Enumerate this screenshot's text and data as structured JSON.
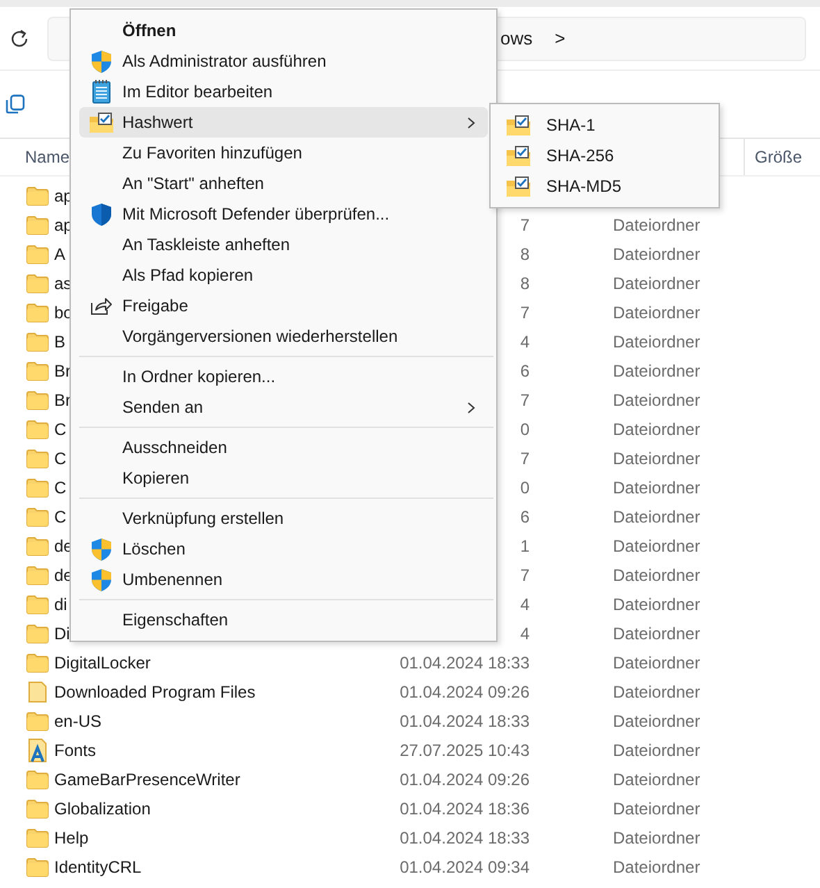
{
  "address_bar": {
    "path_text": "ows",
    "chevron": ">"
  },
  "columns": {
    "name": "Name",
    "size": "Größe"
  },
  "rows": [
    {
      "kind": "folder",
      "name": "ap",
      "date": "",
      "type": ""
    },
    {
      "kind": "folder",
      "name": "ap",
      "date": "7",
      "type": "Dateiordner"
    },
    {
      "kind": "folder",
      "name": "A",
      "date": "8",
      "type": "Dateiordner"
    },
    {
      "kind": "folder",
      "name": "as",
      "date": "8",
      "type": "Dateiordner"
    },
    {
      "kind": "folder",
      "name": "bo",
      "date": "7",
      "type": "Dateiordner"
    },
    {
      "kind": "folder",
      "name": "B",
      "date": "4",
      "type": "Dateiordner"
    },
    {
      "kind": "folder",
      "name": "Br",
      "date": "6",
      "type": "Dateiordner"
    },
    {
      "kind": "folder",
      "name": "Br",
      "date": "7",
      "type": "Dateiordner"
    },
    {
      "kind": "folder",
      "name": "C",
      "date": "0",
      "type": "Dateiordner"
    },
    {
      "kind": "folder",
      "name": "C",
      "date": "7",
      "type": "Dateiordner"
    },
    {
      "kind": "folder",
      "name": "C",
      "date": "0",
      "type": "Dateiordner"
    },
    {
      "kind": "folder",
      "name": "C",
      "date": "6",
      "type": "Dateiordner"
    },
    {
      "kind": "folder",
      "name": "de",
      "date": "1",
      "type": "Dateiordner"
    },
    {
      "kind": "folder",
      "name": "de",
      "date": "7",
      "type": "Dateiordner"
    },
    {
      "kind": "folder",
      "name": "di",
      "date": "4",
      "type": "Dateiordner"
    },
    {
      "kind": "folder",
      "name": "Di",
      "date": "4",
      "type": "Dateiordner"
    },
    {
      "kind": "folder",
      "name": "DigitalLocker",
      "date": "01.04.2024 18:33",
      "type": "Dateiordner"
    },
    {
      "kind": "special",
      "name": "Downloaded Program Files",
      "date": "01.04.2024 09:26",
      "type": "Dateiordner"
    },
    {
      "kind": "folder",
      "name": "en-US",
      "date": "01.04.2024 18:33",
      "type": "Dateiordner"
    },
    {
      "kind": "fonts",
      "name": "Fonts",
      "date": "27.07.2025 10:43",
      "type": "Dateiordner"
    },
    {
      "kind": "folder",
      "name": "GameBarPresenceWriter",
      "date": "01.04.2024 09:26",
      "type": "Dateiordner"
    },
    {
      "kind": "folder",
      "name": "Globalization",
      "date": "01.04.2024 18:36",
      "type": "Dateiordner"
    },
    {
      "kind": "folder",
      "name": "Help",
      "date": "01.04.2024 18:33",
      "type": "Dateiordner"
    },
    {
      "kind": "folder",
      "name": "IdentityCRL",
      "date": "01.04.2024 09:34",
      "type": "Dateiordner"
    }
  ],
  "context_menu": {
    "items": [
      {
        "kind": "default",
        "label": "Öffnen",
        "selected": false
      },
      {
        "kind": "shield",
        "label": "Als Administrator ausführen",
        "selected": false
      },
      {
        "kind": "notepad",
        "label": "Im Editor bearbeiten",
        "selected": false
      },
      {
        "kind": "hash",
        "label": "Hashwert",
        "submenu": true,
        "selected": true
      },
      {
        "kind": "plain",
        "label": "Zu Favoriten hinzufügen",
        "selected": false
      },
      {
        "kind": "plain",
        "label": "An \"Start\" anheften",
        "selected": false
      },
      {
        "kind": "defender",
        "label": "Mit Microsoft Defender überprüfen...",
        "selected": false
      },
      {
        "kind": "plain",
        "label": "An Taskleiste anheften",
        "selected": false
      },
      {
        "kind": "plain",
        "label": "Als Pfad kopieren",
        "selected": false
      },
      {
        "kind": "share",
        "label": "Freigabe",
        "selected": false
      },
      {
        "kind": "plain",
        "label": "Vorgängerversionen wiederherstellen",
        "selected": false
      },
      {
        "kind": "separator"
      },
      {
        "kind": "plain",
        "label": "In Ordner kopieren...",
        "selected": false
      },
      {
        "kind": "plain",
        "label": "Senden an",
        "submenu": true,
        "selected": false
      },
      {
        "kind": "separator"
      },
      {
        "kind": "plain",
        "label": "Ausschneiden",
        "selected": false
      },
      {
        "kind": "plain",
        "label": "Kopieren",
        "selected": false
      },
      {
        "kind": "separator"
      },
      {
        "kind": "plain",
        "label": "Verknüpfung erstellen",
        "selected": false
      },
      {
        "kind": "shield",
        "label": "Löschen",
        "selected": false
      },
      {
        "kind": "shield",
        "label": "Umbenennen",
        "selected": false
      },
      {
        "kind": "separator"
      },
      {
        "kind": "plain",
        "label": "Eigenschaften",
        "selected": false
      }
    ]
  },
  "submenu": {
    "items": [
      {
        "kind": "hash",
        "label": "SHA-1",
        "selected": false
      },
      {
        "kind": "hash",
        "label": "SHA-256",
        "selected": false
      },
      {
        "kind": "hash",
        "label": "SHA-MD5",
        "selected": false
      }
    ]
  }
}
